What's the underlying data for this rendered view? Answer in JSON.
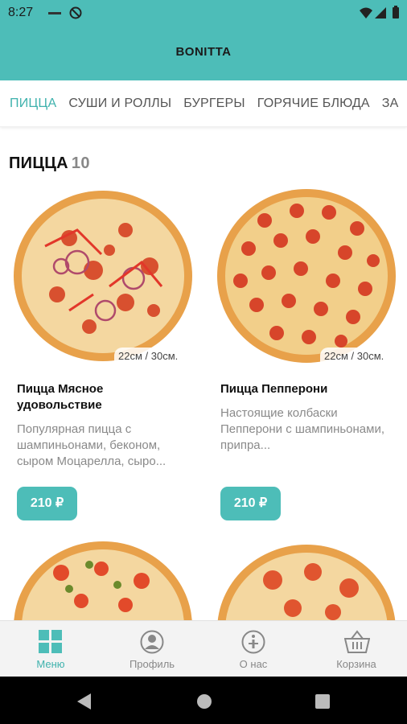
{
  "status_bar": {
    "time": "8:27"
  },
  "app": {
    "title": "BONITTA"
  },
  "tabs": [
    "ПИЦЦА",
    "СУШИ И РОЛЛЫ",
    "БУРГЕРЫ",
    "ГОРЯЧИЕ БЛЮДА",
    "ЗА"
  ],
  "active_tab": 0,
  "section": {
    "title": "ПИЦЦА",
    "count": "10"
  },
  "products": [
    {
      "size": "22см / 30см.",
      "name": "Пицца Мясное удовольствие",
      "description": "Популярная пицца с шампиньонами, беконом, сыром Моцарелла, сыро...",
      "price": "210 ₽"
    },
    {
      "size": "22см / 30см.",
      "name": "Пицца Пепперони",
      "description": "Настоящие колбаски Пепперони с шампиньонами, припра...",
      "price": "210 ₽"
    }
  ],
  "bottom_nav": [
    {
      "label": "Меню",
      "icon": "grid-icon",
      "active": true
    },
    {
      "label": "Профиль",
      "icon": "profile-icon",
      "active": false
    },
    {
      "label": "О нас",
      "icon": "info-icon",
      "active": false
    },
    {
      "label": "Корзина",
      "icon": "basket-icon",
      "active": false
    }
  ],
  "colors": {
    "accent": "#4dbdb8",
    "active_text": "#3fb2ad"
  }
}
